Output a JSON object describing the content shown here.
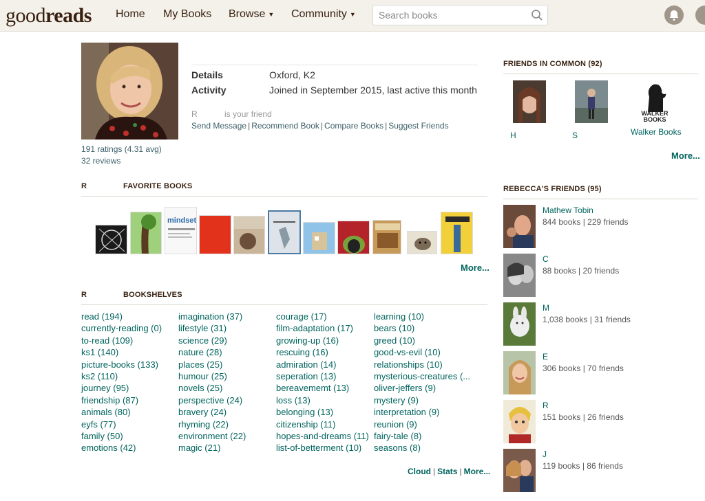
{
  "header": {
    "logo_light": "good",
    "logo_bold": "reads",
    "nav": {
      "home": "Home",
      "my_books": "My Books",
      "browse": "Browse",
      "community": "Community"
    },
    "search_placeholder": "Search books"
  },
  "profile": {
    "ratings": "191 ratings (4.31 avg)",
    "reviews": "32 reviews",
    "details_label": "Details",
    "details_value": "Oxford, K2",
    "activity_label": "Activity",
    "activity_value": "Joined in September 2015, last active this month",
    "friend_initial": "R",
    "friend_text": "is your friend",
    "actions": {
      "send": "Send Message",
      "recommend": "Recommend Book",
      "compare": "Compare Books",
      "suggest": "Suggest Friends"
    }
  },
  "favorites": {
    "initial": "R",
    "heading": "FAVORITE BOOKS",
    "more": "More..."
  },
  "shelves": {
    "initial": "R",
    "heading": "BOOKSHELVES",
    "col1": [
      "read (194)",
      "currently-reading (0)",
      "to-read (109)",
      "ks1 (140)",
      "picture-books (133)",
      "ks2 (110)",
      "journey (95)",
      "friendship (87)",
      "animals (80)",
      "eyfs (77)",
      "family (50)",
      "emotions (42)"
    ],
    "col2": [
      "imagination (37)",
      "lifestyle (31)",
      "science (29)",
      "nature (28)",
      "places (25)",
      "humour (25)",
      "novels (25)",
      "perspective (24)",
      "bravery (24)",
      "rhyming (22)",
      "environment (22)",
      "magic (21)"
    ],
    "col3": [
      "courage (17)",
      "film-adaptation (17)",
      "growing-up (16)",
      "rescuing (16)",
      "admiration (14)",
      "seperation (13)",
      "bereavememt (13)",
      "loss (13)",
      "belonging (13)",
      "citizenship (11)",
      "hopes-and-dreams (11)",
      "list-of-betterment (10)"
    ],
    "col4": [
      "learning (10)",
      "bears (10)",
      "greed (10)",
      "good-vs-evil (10)",
      "relationships (10)",
      "mysterious-creatures (...",
      "oliver-jeffers (9)",
      "mystery (9)",
      "interpretation (9)",
      "reunion (9)",
      "fairy-tale (8)",
      "seasons (8)"
    ],
    "footer": {
      "cloud": "Cloud",
      "stats": "Stats",
      "more": "More..."
    }
  },
  "friends_in_common": {
    "heading": "FRIENDS IN COMMON (92)",
    "people": [
      {
        "name": "H"
      },
      {
        "name": "S"
      },
      {
        "name": "Walker Books"
      }
    ],
    "walker_logo": "WALKER BOOKS",
    "more": "More..."
  },
  "friends": {
    "heading": "REBECCA'S FRIENDS (95)",
    "list": [
      {
        "name": "Mathew Tobin",
        "meta": "844 books | 229 friends"
      },
      {
        "name": "C",
        "meta": "88 books | 20 friends"
      },
      {
        "name": "M",
        "meta": "1,038 books | 31 friends"
      },
      {
        "name": "E",
        "meta": "306 books | 70 friends"
      },
      {
        "name": "R",
        "meta": "151 books | 26 friends"
      },
      {
        "name": "J",
        "meta": "119 books | 86 friends"
      }
    ]
  },
  "colors": {
    "brand_brown": "#382110",
    "link_green": "#00635d",
    "header_bg": "#f4f1ea"
  }
}
